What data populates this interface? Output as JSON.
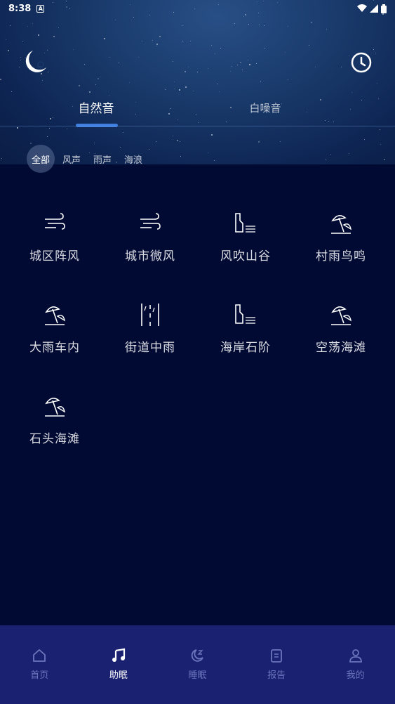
{
  "status_bar": {
    "time": "8:38",
    "notification_glyph": "A"
  },
  "header": {
    "icons": {
      "left": "moon-icon",
      "right": "clock-icon"
    },
    "tabs": [
      {
        "label": "自然音",
        "active": true
      },
      {
        "label": "白噪音",
        "active": false
      }
    ],
    "chips": [
      {
        "label": "全部",
        "active": true
      },
      {
        "label": "风声",
        "active": false
      },
      {
        "label": "雨声",
        "active": false
      },
      {
        "label": "海浪",
        "active": false
      }
    ]
  },
  "sounds": [
    {
      "label": "城区阵风",
      "icon": "wind-icon"
    },
    {
      "label": "城市微风",
      "icon": "wind-icon"
    },
    {
      "label": "风吹山谷",
      "icon": "cliff-icon"
    },
    {
      "label": "村雨鸟鸣",
      "icon": "beach-umbrella-icon"
    },
    {
      "label": "大雨车内",
      "icon": "beach-umbrella-icon"
    },
    {
      "label": "街道中雨",
      "icon": "road-icon"
    },
    {
      "label": "海岸石阶",
      "icon": "cliff-icon"
    },
    {
      "label": "空荡海滩",
      "icon": "beach-umbrella-icon"
    },
    {
      "label": "石头海滩",
      "icon": "beach-umbrella-icon"
    }
  ],
  "bottom_nav": [
    {
      "label": "首页",
      "icon": "home-icon",
      "active": false
    },
    {
      "label": "助眠",
      "icon": "music-note-icon",
      "active": true
    },
    {
      "label": "睡眠",
      "icon": "sleep-moon-icon",
      "active": false
    },
    {
      "label": "报告",
      "icon": "report-icon",
      "active": false
    },
    {
      "label": "我的",
      "icon": "profile-icon",
      "active": false
    }
  ],
  "colors": {
    "accent": "#3f7fe0",
    "background": "#000a33",
    "nav_bg": "#1a2170",
    "nav_inactive": "#6b76bd"
  }
}
